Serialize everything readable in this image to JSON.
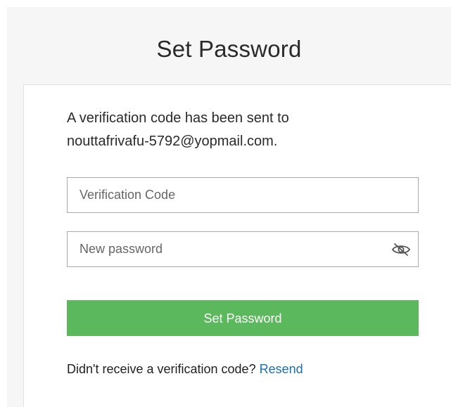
{
  "header": {
    "title": "Set Password"
  },
  "message": {
    "line1": "A verification code has been sent to",
    "line2": "nouttafrivafu-5792@yopmail.com."
  },
  "form": {
    "verification_code": {
      "value": "",
      "placeholder": "Verification Code"
    },
    "new_password": {
      "value": "",
      "placeholder": "New password",
      "toggle_icon": "eye-slash-icon"
    },
    "submit_label": "Set Password"
  },
  "footer": {
    "prompt": "Didn't receive a verification code?",
    "resend_label": "Resend"
  },
  "colors": {
    "background": "#f6f6f6",
    "card": "#ffffff",
    "primary_button": "#5cb85c",
    "link": "#1a6fb0",
    "text": "#2a2a2a"
  }
}
